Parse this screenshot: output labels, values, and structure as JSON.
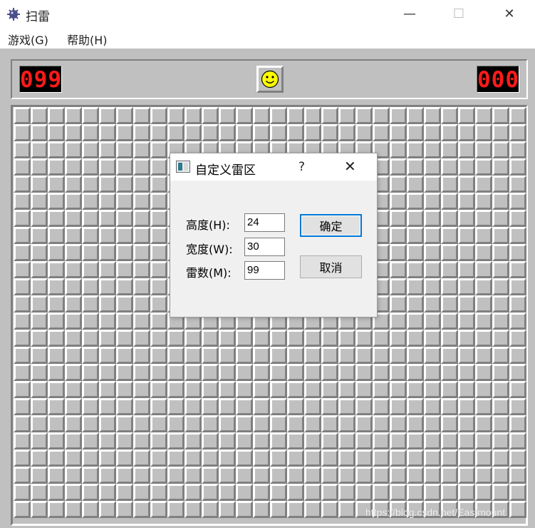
{
  "window": {
    "title": "扫雷",
    "minimize_glyph": "—",
    "maximize_glyph": "☐",
    "close_glyph": "✕"
  },
  "menu": {
    "items": [
      {
        "label": "游戏(G)"
      },
      {
        "label": "帮助(H)"
      }
    ]
  },
  "status": {
    "mine_counter": "099",
    "timer": "000",
    "face": "smiley"
  },
  "board": {
    "rows": 24,
    "cols": 30,
    "state": "all-covered"
  },
  "dialog": {
    "title": "自定义雷区",
    "help_glyph": "?",
    "close_glyph": "✕",
    "fields": [
      {
        "label": "高度(H):",
        "value": "24"
      },
      {
        "label": "宽度(W):",
        "value": "30"
      },
      {
        "label": "雷数(M):",
        "value": "99"
      }
    ],
    "ok_label": "确定",
    "cancel_label": "取消"
  },
  "watermark": "https://blog.csdn.net/Eastmount",
  "colors": {
    "face_bg": "#c0c0c0",
    "counter_digits": "#ff1a1a",
    "focus_border": "#0078d7"
  }
}
